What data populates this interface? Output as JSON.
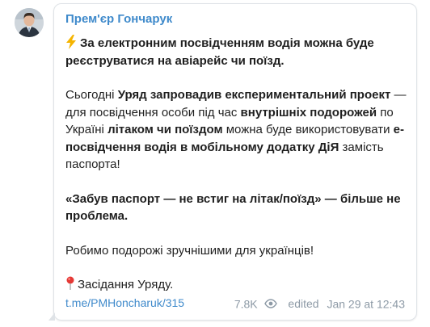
{
  "channel": {
    "name": "Прем'єр Гончарук"
  },
  "message": {
    "line1_a": "За електронним посвідченням водія можна буде",
    "line1_b": "реєструватися на авіарейс чи поїзд.",
    "p2": [
      {
        "t": "Сьогодні ",
        "b": false
      },
      {
        "t": "Уряд запровадив експериментальний проект",
        "b": true
      },
      {
        "t": " — для посвідчення особи під час ",
        "b": false
      },
      {
        "t": "внутрішніх подорожей",
        "b": true
      },
      {
        "t": " по Україні ",
        "b": false
      },
      {
        "t": "літаком чи поїздом",
        "b": true
      },
      {
        "t": " можна буде використовувати ",
        "b": false
      },
      {
        "t": "е-посвідчення водія в мобільному додатку ДіЯ",
        "b": true
      },
      {
        "t": " замість паспорта!",
        "b": false
      }
    ],
    "p3": "«Забув паспорт — не встиг на літак/поїзд» — більше не проблема.",
    "p4": "Робимо подорожі зручнішими для українців!",
    "p5": "Засідання Уряду."
  },
  "footer": {
    "link": "t.me/PMHoncharuk/315",
    "views": "7.8K",
    "edited": "edited",
    "time": "Jan 29 at 12:43"
  },
  "colors": {
    "accent": "#3f8acb",
    "meta": "#8d9aa6"
  },
  "icons": [
    "avatar",
    "lightning-emoji",
    "pin-emoji",
    "eye-icon"
  ]
}
